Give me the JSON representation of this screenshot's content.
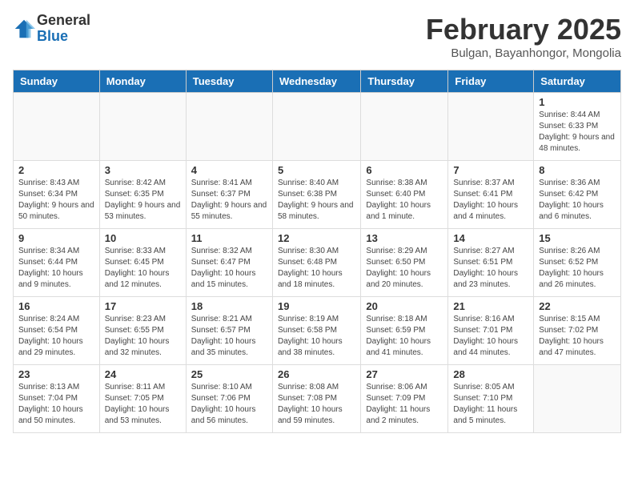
{
  "header": {
    "logo_general": "General",
    "logo_blue": "Blue",
    "month_title": "February 2025",
    "location": "Bulgan, Bayanhongor, Mongolia"
  },
  "days_of_week": [
    "Sunday",
    "Monday",
    "Tuesday",
    "Wednesday",
    "Thursday",
    "Friday",
    "Saturday"
  ],
  "weeks": [
    [
      {
        "day": "",
        "info": ""
      },
      {
        "day": "",
        "info": ""
      },
      {
        "day": "",
        "info": ""
      },
      {
        "day": "",
        "info": ""
      },
      {
        "day": "",
        "info": ""
      },
      {
        "day": "",
        "info": ""
      },
      {
        "day": "1",
        "info": "Sunrise: 8:44 AM\nSunset: 6:33 PM\nDaylight: 9 hours and 48 minutes."
      }
    ],
    [
      {
        "day": "2",
        "info": "Sunrise: 8:43 AM\nSunset: 6:34 PM\nDaylight: 9 hours and 50 minutes."
      },
      {
        "day": "3",
        "info": "Sunrise: 8:42 AM\nSunset: 6:35 PM\nDaylight: 9 hours and 53 minutes."
      },
      {
        "day": "4",
        "info": "Sunrise: 8:41 AM\nSunset: 6:37 PM\nDaylight: 9 hours and 55 minutes."
      },
      {
        "day": "5",
        "info": "Sunrise: 8:40 AM\nSunset: 6:38 PM\nDaylight: 9 hours and 58 minutes."
      },
      {
        "day": "6",
        "info": "Sunrise: 8:38 AM\nSunset: 6:40 PM\nDaylight: 10 hours and 1 minute."
      },
      {
        "day": "7",
        "info": "Sunrise: 8:37 AM\nSunset: 6:41 PM\nDaylight: 10 hours and 4 minutes."
      },
      {
        "day": "8",
        "info": "Sunrise: 8:36 AM\nSunset: 6:42 PM\nDaylight: 10 hours and 6 minutes."
      }
    ],
    [
      {
        "day": "9",
        "info": "Sunrise: 8:34 AM\nSunset: 6:44 PM\nDaylight: 10 hours and 9 minutes."
      },
      {
        "day": "10",
        "info": "Sunrise: 8:33 AM\nSunset: 6:45 PM\nDaylight: 10 hours and 12 minutes."
      },
      {
        "day": "11",
        "info": "Sunrise: 8:32 AM\nSunset: 6:47 PM\nDaylight: 10 hours and 15 minutes."
      },
      {
        "day": "12",
        "info": "Sunrise: 8:30 AM\nSunset: 6:48 PM\nDaylight: 10 hours and 18 minutes."
      },
      {
        "day": "13",
        "info": "Sunrise: 8:29 AM\nSunset: 6:50 PM\nDaylight: 10 hours and 20 minutes."
      },
      {
        "day": "14",
        "info": "Sunrise: 8:27 AM\nSunset: 6:51 PM\nDaylight: 10 hours and 23 minutes."
      },
      {
        "day": "15",
        "info": "Sunrise: 8:26 AM\nSunset: 6:52 PM\nDaylight: 10 hours and 26 minutes."
      }
    ],
    [
      {
        "day": "16",
        "info": "Sunrise: 8:24 AM\nSunset: 6:54 PM\nDaylight: 10 hours and 29 minutes."
      },
      {
        "day": "17",
        "info": "Sunrise: 8:23 AM\nSunset: 6:55 PM\nDaylight: 10 hours and 32 minutes."
      },
      {
        "day": "18",
        "info": "Sunrise: 8:21 AM\nSunset: 6:57 PM\nDaylight: 10 hours and 35 minutes."
      },
      {
        "day": "19",
        "info": "Sunrise: 8:19 AM\nSunset: 6:58 PM\nDaylight: 10 hours and 38 minutes."
      },
      {
        "day": "20",
        "info": "Sunrise: 8:18 AM\nSunset: 6:59 PM\nDaylight: 10 hours and 41 minutes."
      },
      {
        "day": "21",
        "info": "Sunrise: 8:16 AM\nSunset: 7:01 PM\nDaylight: 10 hours and 44 minutes."
      },
      {
        "day": "22",
        "info": "Sunrise: 8:15 AM\nSunset: 7:02 PM\nDaylight: 10 hours and 47 minutes."
      }
    ],
    [
      {
        "day": "23",
        "info": "Sunrise: 8:13 AM\nSunset: 7:04 PM\nDaylight: 10 hours and 50 minutes."
      },
      {
        "day": "24",
        "info": "Sunrise: 8:11 AM\nSunset: 7:05 PM\nDaylight: 10 hours and 53 minutes."
      },
      {
        "day": "25",
        "info": "Sunrise: 8:10 AM\nSunset: 7:06 PM\nDaylight: 10 hours and 56 minutes."
      },
      {
        "day": "26",
        "info": "Sunrise: 8:08 AM\nSunset: 7:08 PM\nDaylight: 10 hours and 59 minutes."
      },
      {
        "day": "27",
        "info": "Sunrise: 8:06 AM\nSunset: 7:09 PM\nDaylight: 11 hours and 2 minutes."
      },
      {
        "day": "28",
        "info": "Sunrise: 8:05 AM\nSunset: 7:10 PM\nDaylight: 11 hours and 5 minutes."
      },
      {
        "day": "",
        "info": ""
      }
    ]
  ]
}
